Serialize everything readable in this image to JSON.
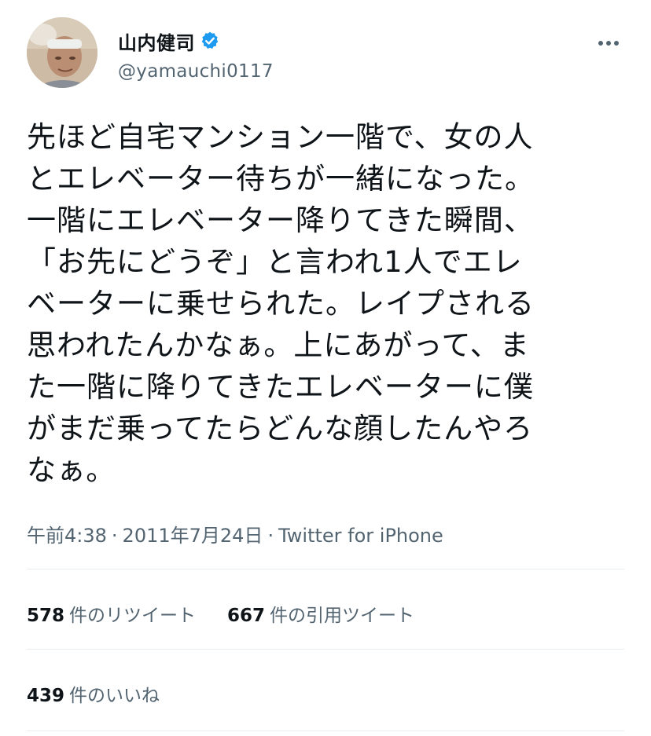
{
  "author": {
    "display_name": "山内健司",
    "handle": "@yamauchi0117",
    "verified": true,
    "verified_color": "#1d9bf0"
  },
  "tweet": {
    "text": "先ほど自宅マンション一階で、女の人\nとエレベーター待ちが一緒になった。\n一階にエレベーター降りてきた瞬間、\n「お先にどうぞ」と言われ1人でエレ\nベーターに乗せられた。レイプされる\n思われたんかなぁ。上にあがって、ま\nた一階に降りてきたエレベーターに僕\nがまだ乗ってたらどんな顔したんやろ\nなぁ。",
    "time": "午前4:38",
    "date": "2011年7月24日",
    "source": "Twitter for iPhone",
    "separator": "·"
  },
  "stats": {
    "retweets_count": "578",
    "retweets_label": "件のリツイート",
    "quotes_count": "667",
    "quotes_label": "件の引用ツイート",
    "likes_count": "439",
    "likes_label": "件のいいね"
  },
  "icons": {
    "verified": "verified-badge-icon",
    "more": "more-options-icon"
  }
}
